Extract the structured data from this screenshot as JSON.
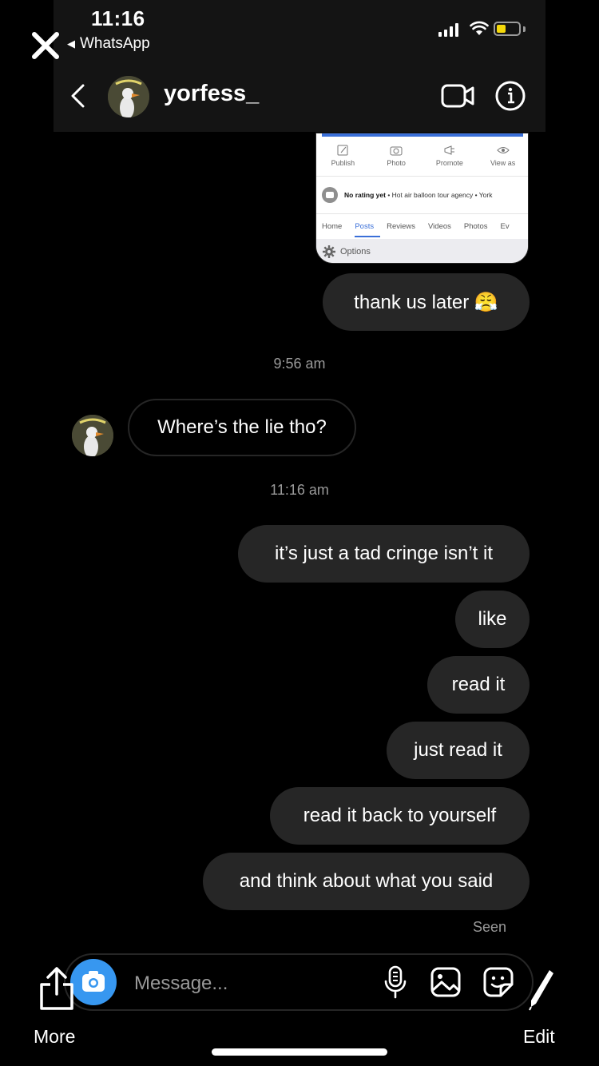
{
  "status_bar": {
    "time": "11:16",
    "back_app": "WhatsApp"
  },
  "header": {
    "username": "yorfess_"
  },
  "shared_screenshot": {
    "actions": [
      "Publish",
      "Photo",
      "Promote",
      "View as"
    ],
    "rating_bold": "No rating yet",
    "rating_rest": " • Hot air balloon tour agency • York",
    "tabs": [
      "Home",
      "Posts",
      "Reviews",
      "Videos",
      "Photos",
      "Ev"
    ],
    "active_tab": "Posts",
    "options_label": "Options"
  },
  "messages": {
    "m1": "thank us later 😤",
    "ts1": "9:56 am",
    "m2": "Where’s the lie tho?",
    "ts2": "11:16 am",
    "m3": "it’s just a tad cringe isn’t it",
    "m4": "like",
    "m5": "read it",
    "m6": "just read it",
    "m7": "read it back to yourself",
    "m8": "and think about what you said",
    "seen": "Seen"
  },
  "composer": {
    "placeholder": "Message..."
  },
  "bottom": {
    "more": "More",
    "edit": "Edit"
  },
  "colors": {
    "accent_blue": "#3797f0",
    "bubble": "#262626",
    "battery": "#f5d90a"
  }
}
